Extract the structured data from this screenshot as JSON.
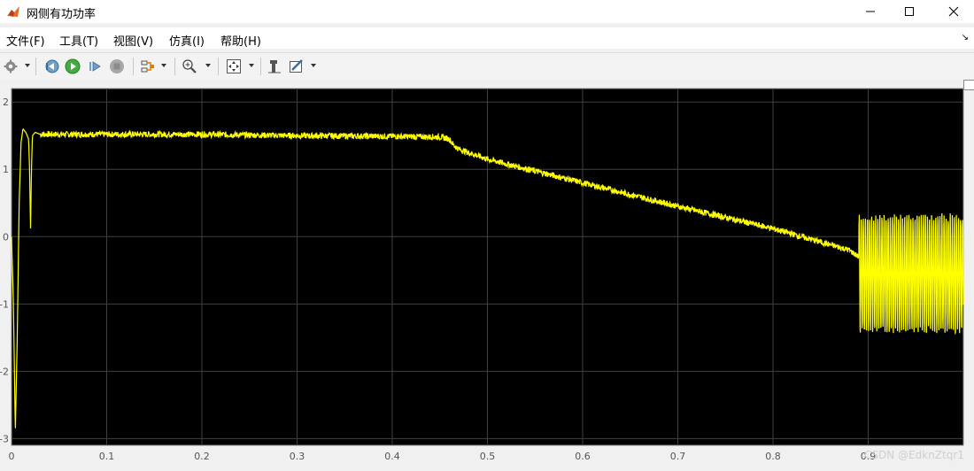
{
  "window": {
    "title": "网侧有功功率",
    "app_icon": "matlab-icon",
    "controls": [
      "minimize-icon",
      "maximize-icon",
      "close-icon"
    ]
  },
  "menubar": {
    "items": [
      {
        "label": "文件(F)"
      },
      {
        "label": "工具(T)"
      },
      {
        "label": "视图(V)"
      },
      {
        "label": "仿真(I)"
      },
      {
        "label": "帮助(H)"
      }
    ],
    "corner_icon": "menu-dock-icon"
  },
  "toolbar": {
    "buttons": [
      "settings-icon",
      "step-back-icon",
      "run-icon",
      "step-forward-icon",
      "stop-icon",
      "highlight-icon",
      "zoom-in-icon",
      "fit-to-view-icon",
      "cursor-measure-icon",
      "style-icon"
    ]
  },
  "colors": {
    "plot_background": "#000000",
    "grid": "#404040",
    "signal": "#ffff00",
    "axis_text": "#d9d9d9"
  },
  "chart_data": {
    "type": "line",
    "xlim": [
      0,
      1.0
    ],
    "ylim": [
      -3.1,
      2.2
    ],
    "xticks": [
      0,
      0.1,
      0.2,
      0.3,
      0.4,
      0.5,
      0.6,
      0.7,
      0.8,
      0.9
    ],
    "xtick_labels": [
      "0",
      "0.1",
      "0.2",
      "0.3",
      "0.4",
      "0.5",
      "0.6",
      "0.7",
      "0.8",
      "0.9"
    ],
    "yticks": [
      2,
      1,
      0,
      -1,
      -2,
      -3
    ],
    "ytick_labels": [
      "2",
      "1",
      "0",
      "-1",
      "-2",
      "-3"
    ],
    "grid": true,
    "series": [
      {
        "color": "#ffff00",
        "x": [
          0,
          0.002,
          0.004,
          0.006,
          0.008,
          0.01,
          0.012,
          0.015,
          0.018,
          0.019,
          0.02,
          0.021,
          0.022,
          0.025,
          0.03,
          0.05,
          0.1,
          0.2,
          0.3,
          0.4,
          0.45,
          0.46,
          0.465,
          0.47,
          0.5,
          0.6,
          0.7,
          0.8,
          0.88,
          0.89
        ],
        "y": [
          0,
          -1.0,
          -2.9,
          -1.5,
          0.5,
          1.4,
          1.6,
          1.55,
          1.45,
          1.0,
          0.1,
          1.0,
          1.5,
          1.55,
          1.52,
          1.52,
          1.52,
          1.52,
          1.5,
          1.49,
          1.48,
          1.45,
          1.35,
          1.3,
          1.15,
          0.8,
          0.45,
          0.12,
          -0.2,
          -0.3
        ],
        "oscillation": {
          "x_start": 0.89,
          "x_end": 1.0,
          "y_max": 0.35,
          "y_min": -1.45
        }
      }
    ]
  },
  "watermark": "CSDN @EdknZtqr1"
}
